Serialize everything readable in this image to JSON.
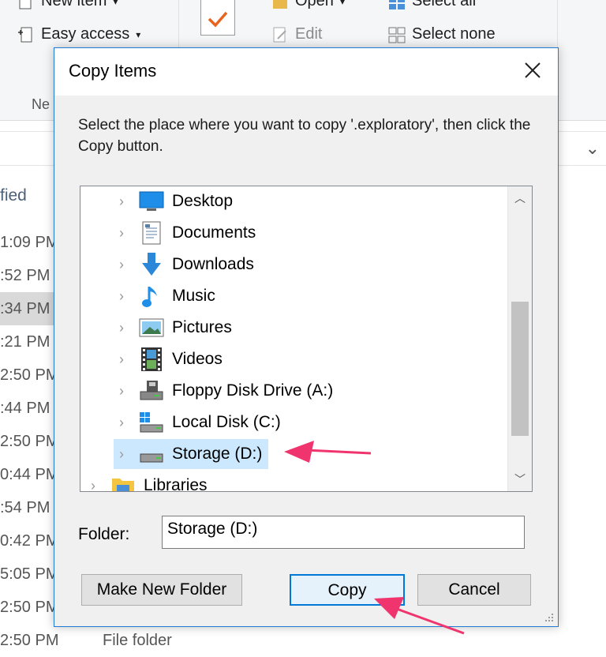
{
  "ribbon": {
    "new_item": "New item",
    "easy_access": "Easy access",
    "open": "Open",
    "edit": "Edit",
    "select_all": "Select all",
    "select_none": "Select none",
    "group_new": "Ne"
  },
  "list": {
    "column_header": "fied",
    "times": [
      "1:09 PM",
      ":52 PM",
      ":34 PM",
      ":21 PM",
      "2:50 PM",
      ":44 PM",
      "2:50 PM",
      "0:44 PM",
      ":54 PM",
      "0:42 PM",
      "5:05 PM",
      "2:50 PM"
    ],
    "selected_index": 2,
    "bottom_time": "2:50 PM",
    "bottom_type": "File folder"
  },
  "dialog": {
    "title": "Copy Items",
    "instruction": "Select the place where you want to copy '.exploratory', then click the Copy button.",
    "tree": [
      {
        "label": "Desktop",
        "icon": "desktop-icon"
      },
      {
        "label": "Documents",
        "icon": "documents-icon"
      },
      {
        "label": "Downloads",
        "icon": "downloads-icon"
      },
      {
        "label": "Music",
        "icon": "music-icon"
      },
      {
        "label": "Pictures",
        "icon": "pictures-icon"
      },
      {
        "label": "Videos",
        "icon": "videos-icon"
      },
      {
        "label": "Floppy Disk Drive (A:)",
        "icon": "floppy-drive-icon"
      },
      {
        "label": "Local Disk (C:)",
        "icon": "local-disk-icon"
      },
      {
        "label": "Storage (D:)",
        "icon": "storage-drive-icon",
        "selected": true
      },
      {
        "label": "Libraries",
        "icon": "libraries-icon"
      }
    ],
    "folder_label": "Folder:",
    "folder_value": "Storage (D:)",
    "buttons": {
      "make_new_folder": "Make New Folder",
      "copy": "Copy",
      "cancel": "Cancel"
    }
  },
  "colors": {
    "accent": "#0078d7",
    "selection": "#cce8ff",
    "annotation_arrow": "#f0356e"
  }
}
